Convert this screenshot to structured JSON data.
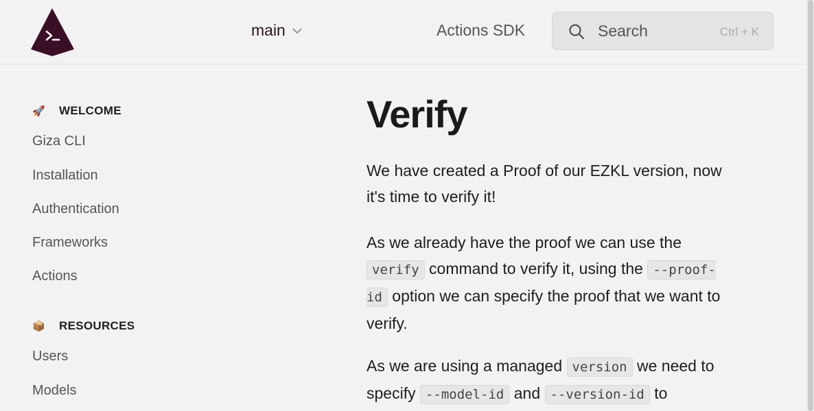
{
  "header": {
    "branch_label": "main",
    "sdk_link": "Actions SDK",
    "search_placeholder": "Search",
    "search_shortcut": "Ctrl + K"
  },
  "sidebar": {
    "sections": [
      {
        "title": "WELCOME",
        "icon": "rocket-icon",
        "emoji": "🚀",
        "items": [
          "Giza CLI",
          "Installation",
          "Authentication",
          "Frameworks",
          "Actions"
        ]
      },
      {
        "title": "RESOURCES",
        "icon": "package-icon",
        "emoji": "📦",
        "items": [
          "Users",
          "Models"
        ]
      }
    ]
  },
  "main": {
    "title": "Verify",
    "p1": "We have created a Proof of our EZKL version, now it's time to verify it!",
    "p2": {
      "t1": "As we already have the proof we can use the ",
      "c1": "verify",
      "t2": " command to verify it, using the ",
      "c2": "--proof-id",
      "t3": " option we can specify the proof that we want to verify."
    },
    "p3": {
      "t1": "As we are using a managed ",
      "c1": "version",
      "t2": " we need to specify ",
      "c2": "--model-id",
      "t3": " and ",
      "c3": "--version-id",
      "t4": " to"
    }
  },
  "colors": {
    "logo": "#3a0f25",
    "background": "#f2f2f2",
    "text": "#1e1e1e",
    "muted": "#555555"
  }
}
